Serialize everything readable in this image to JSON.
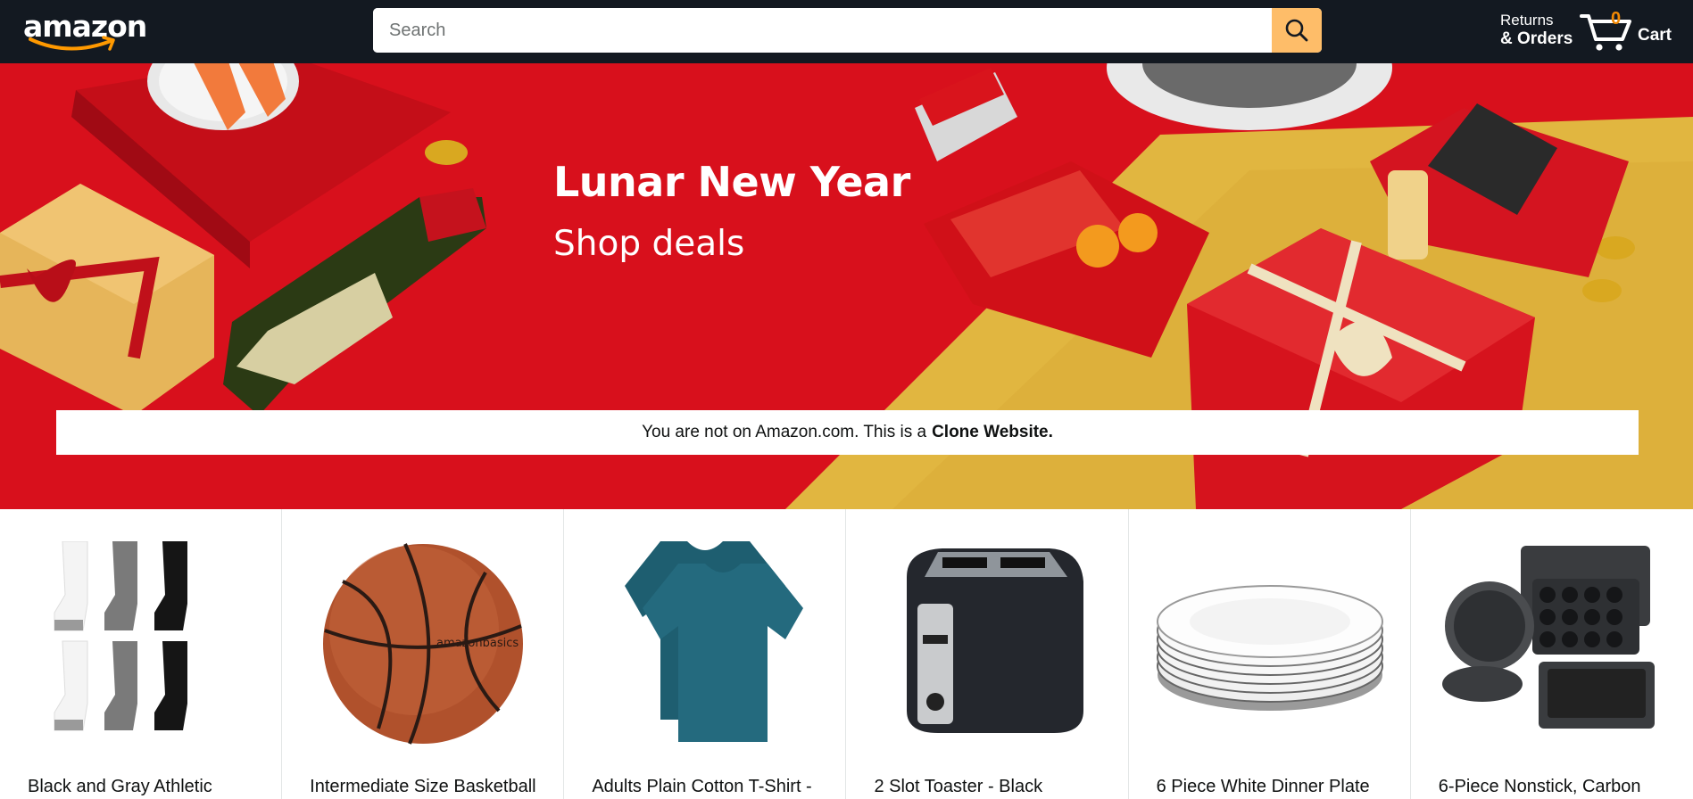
{
  "header": {
    "logo_text": "amazon",
    "search": {
      "placeholder": "Search",
      "value": ""
    },
    "returns_line1": "Returns",
    "returns_line2": "& Orders",
    "cart_count": "0",
    "cart_label": "Cart"
  },
  "hero": {
    "title": "Lunar New Year",
    "subtitle": "Shop deals",
    "notice_text": "You are not on Amazon.com. This is a",
    "notice_bold": "Clone Website."
  },
  "products": [
    {
      "title": "Black and Gray Athletic",
      "icon": "socks-image"
    },
    {
      "title": "Intermediate Size Basketball",
      "icon": "basketball-image"
    },
    {
      "title": "Adults Plain Cotton T-Shirt -",
      "icon": "tshirt-image"
    },
    {
      "title": "2 Slot Toaster - Black",
      "icon": "toaster-image"
    },
    {
      "title": "6 Piece White Dinner Plate",
      "icon": "plates-image"
    },
    {
      "title": "6-Piece Nonstick, Carbon",
      "icon": "bakeware-image"
    }
  ],
  "colors": {
    "header_bg": "#131921",
    "search_button": "#febd69",
    "cart_count": "#f08804",
    "hero_red": "#d8101c",
    "hero_gold": "#e1b640"
  }
}
